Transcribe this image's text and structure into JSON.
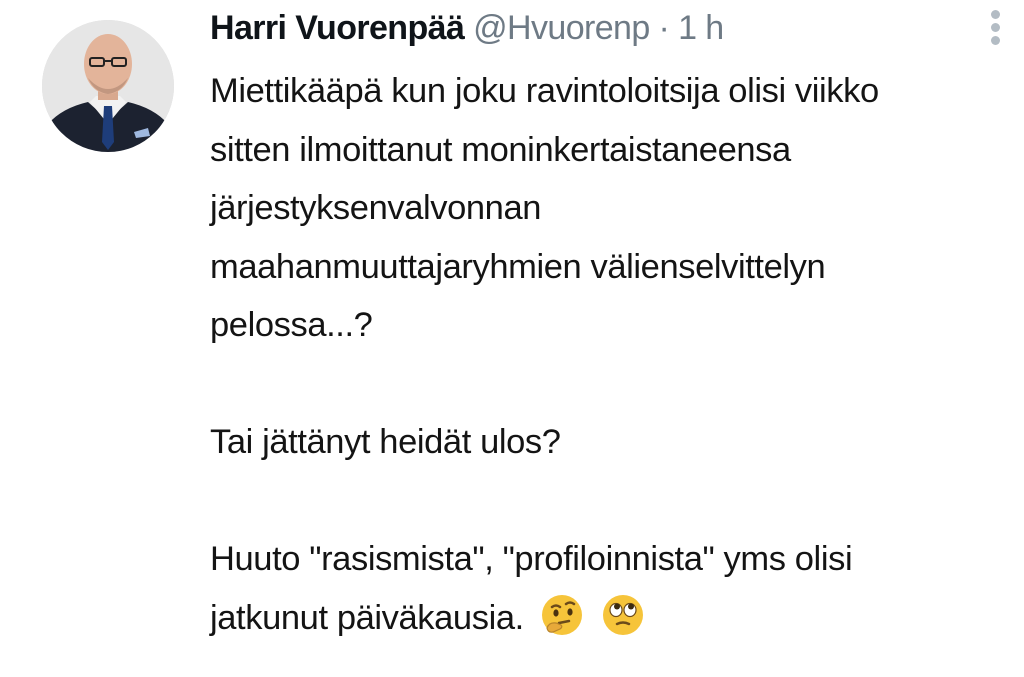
{
  "tweet": {
    "author_name": "Harri Vuorenpää",
    "handle": "@Hvuorenp",
    "separator": "·",
    "time": "1 h",
    "paragraphs": [
      [
        "Miettikääpä kun joku ravintoloitsija olisi viikko",
        "sitten ilmoittanut moninkertaistaneensa",
        "järjestyksenvalvonnan",
        "maahanmuuttajaryhmien välienselvittelyn",
        "pelossa...?"
      ],
      [
        "Tai jättänyt heidät ulos?"
      ],
      [
        "Huuto \"rasismista\", \"profiloinnista\" yms olisi",
        "jatkunut päiväkausia."
      ]
    ],
    "emojis": [
      "thinking-face-emoji",
      "face-with-rolling-eyes-emoji"
    ]
  },
  "icons": {
    "more": "more-vertical-icon",
    "avatar": "avatar"
  },
  "colors": {
    "name": "#0f1419",
    "secondary": "#6e7a85",
    "body_text": "#141414",
    "emoji_yellow": "#f6c43a"
  }
}
